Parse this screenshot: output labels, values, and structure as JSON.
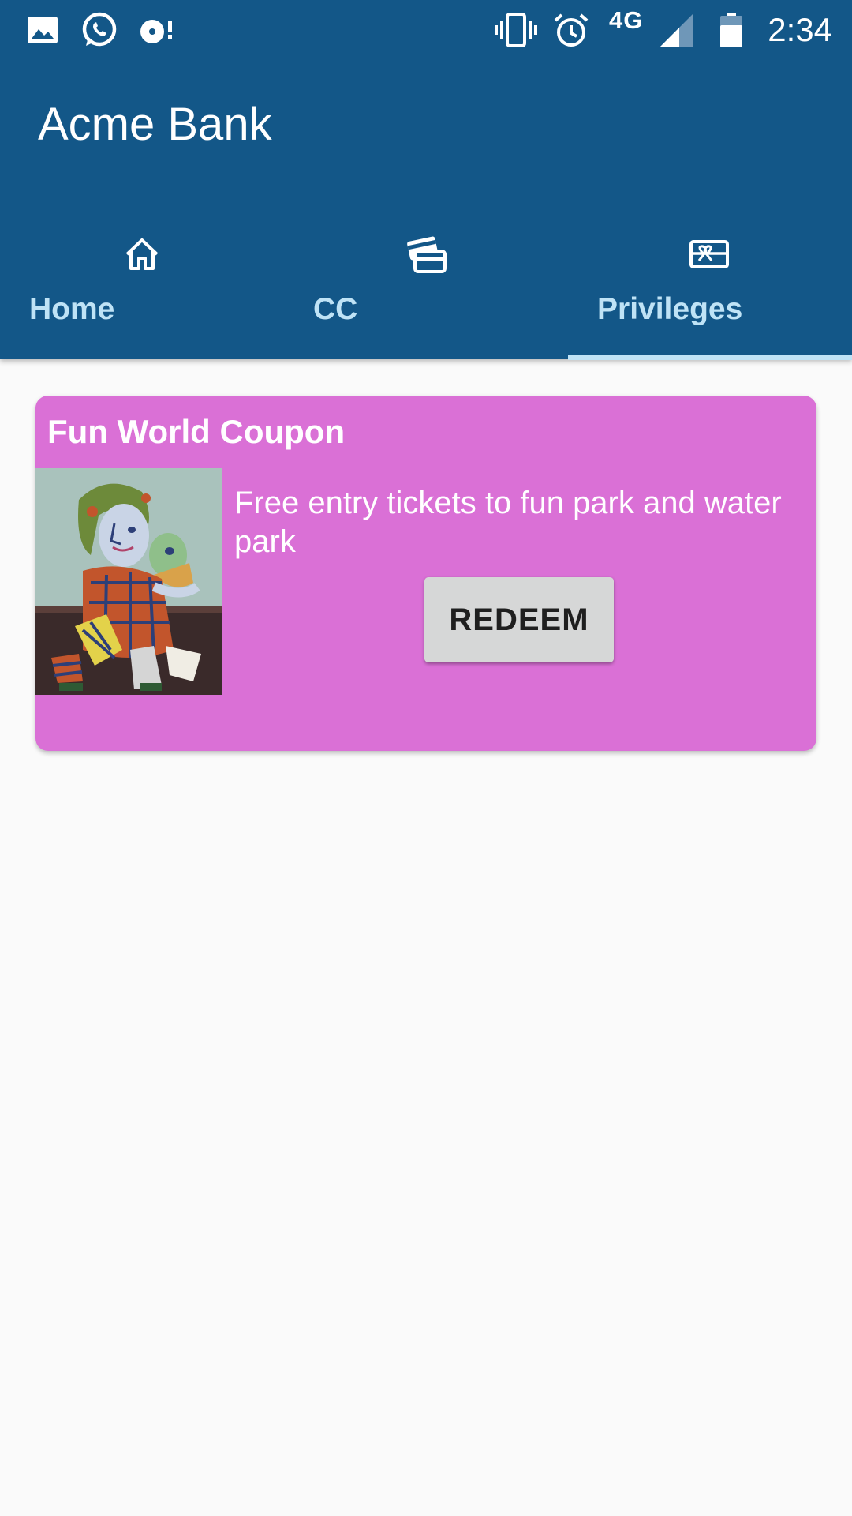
{
  "status_bar": {
    "time": "2:34",
    "network": "4G",
    "icons": [
      "image-icon",
      "whatsapp-icon",
      "sync-icon",
      "vibrate-icon",
      "alarm-icon",
      "signal-icon",
      "battery-icon"
    ]
  },
  "app": {
    "title": "Acme Bank"
  },
  "tabs": [
    {
      "label": "Home",
      "icon": "home-icon"
    },
    {
      "label": "CC",
      "icon": "credit-card-icon"
    },
    {
      "label": "Privileges",
      "icon": "gift-card-icon",
      "selected": true
    }
  ],
  "card": {
    "title": "Fun World Coupon",
    "description": "Free entry tickets to fun park and water park",
    "button_label": "REDEEM",
    "background": "#da70d6"
  },
  "colors": {
    "primary": "#135788",
    "tab_text": "#bfe3f6",
    "background": "#fafafa"
  }
}
